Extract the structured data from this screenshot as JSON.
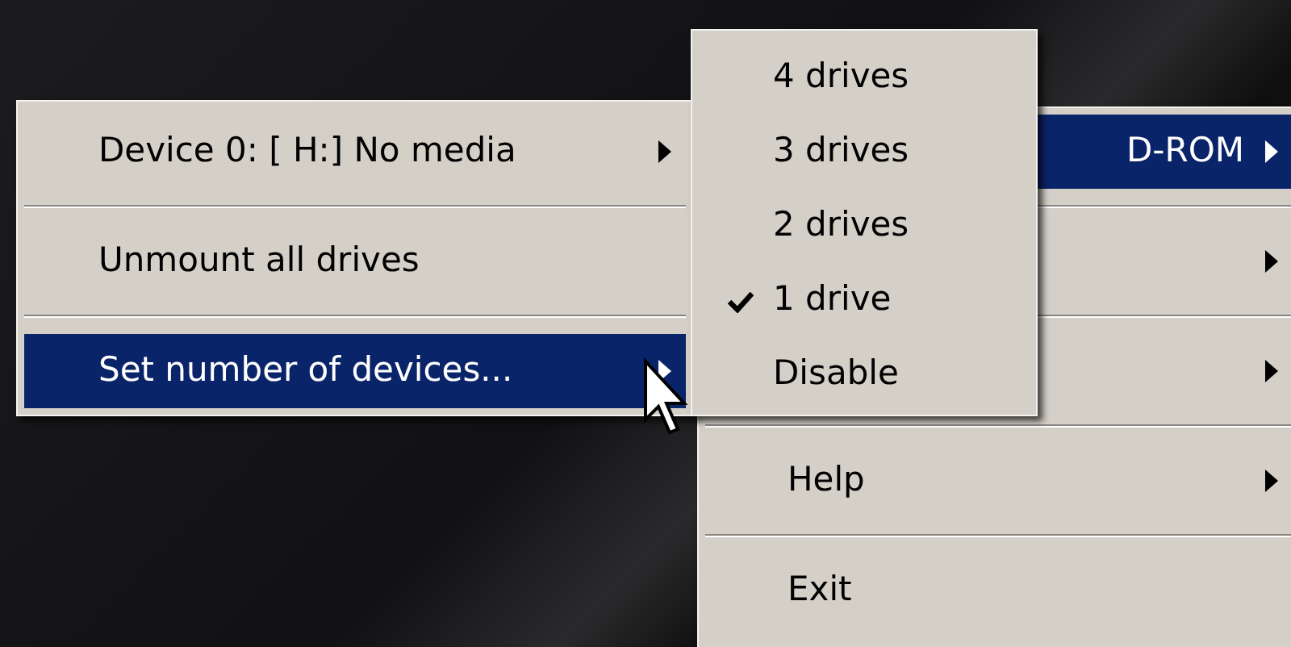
{
  "main_menu": {
    "items": [
      {
        "kind": "cut",
        "label": "D-ROM",
        "selected": true,
        "submenu": true
      },
      {
        "kind": "item",
        "selected": false,
        "submenu": true
      },
      {
        "kind": "item",
        "selected": false,
        "submenu": true
      },
      {
        "kind": "item",
        "label": "Help",
        "selected": false,
        "submenu": true
      },
      {
        "kind": "item",
        "label": "Exit",
        "selected": false,
        "submenu": false
      }
    ]
  },
  "device_menu": {
    "items": [
      {
        "label": "Device 0: [ H:] No media",
        "selected": false,
        "submenu": true
      },
      {
        "label": "Unmount all drives",
        "selected": false,
        "submenu": false
      },
      {
        "label": "Set number of devices...",
        "selected": true,
        "submenu": true
      }
    ]
  },
  "drives_menu": {
    "items": [
      {
        "label": "4 drives",
        "checked": false
      },
      {
        "label": "3 drives",
        "checked": false
      },
      {
        "label": "2 drives",
        "checked": false
      },
      {
        "label": "1 drive",
        "checked": true
      },
      {
        "label": "Disable",
        "checked": false
      }
    ]
  }
}
